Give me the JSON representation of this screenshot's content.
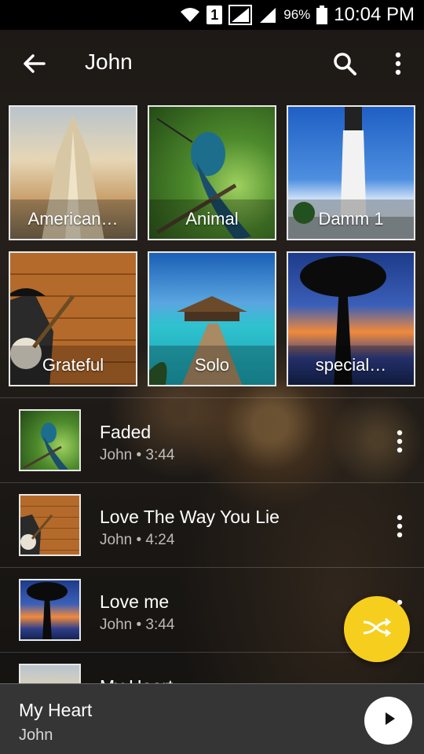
{
  "status_bar": {
    "sim_slot": "1",
    "battery_percent": "96%",
    "time": "10:04 PM"
  },
  "app_bar": {
    "title": "John",
    "icons": [
      "back-arrow-icon",
      "search-icon",
      "more-vert-icon"
    ]
  },
  "albums": [
    {
      "title": "American…"
    },
    {
      "title": "Animal"
    },
    {
      "title": "Damm 1"
    },
    {
      "title": "Grateful"
    },
    {
      "title": "Solo"
    },
    {
      "title": "special…"
    }
  ],
  "songs": [
    {
      "title": "Faded",
      "artist": "John",
      "duration": "3:44",
      "separator": "•"
    },
    {
      "title": "Love The Way You Lie",
      "artist": "John",
      "duration": "4:24",
      "separator": "•"
    },
    {
      "title": "Love me",
      "artist": "John",
      "duration": "3:44",
      "separator": "•"
    },
    {
      "title": "My Heart",
      "artist": "",
      "duration": "",
      "separator": ""
    }
  ],
  "fab": {
    "icon": "shuffle-icon",
    "color": "#f6ce1d"
  },
  "now_playing": {
    "title": "My Heart",
    "artist": "John",
    "icon": "play-icon"
  }
}
